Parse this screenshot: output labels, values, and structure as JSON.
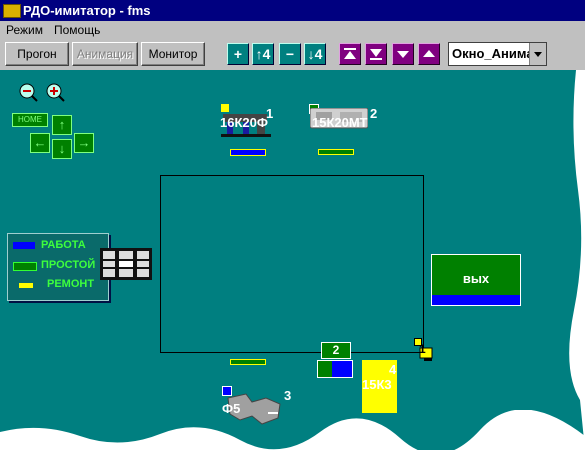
{
  "window": {
    "title": "РДО-имитатор - fms"
  },
  "menu": {
    "items": [
      "Режим",
      "Помощь"
    ]
  },
  "toolbar": {
    "run_label": "Прогон",
    "animation_label": "Анимация",
    "monitor_label": "Монитор",
    "plus_label": "+",
    "up4_label": "↑4",
    "minus_label": "−",
    "down4_label": "↓4",
    "frame_select_value": "Окно_Анима"
  },
  "zoom": {
    "home_label": "HOME"
  },
  "legend": {
    "items": [
      {
        "label": "РАБОТА",
        "color": "#0000ff"
      },
      {
        "label": "ПРОСТОЙ",
        "color": "#008000"
      },
      {
        "label": "РЕМОНТ",
        "color": "#ffff00"
      }
    ]
  },
  "machines": [
    {
      "number": "1",
      "label": "16К20Ф"
    },
    {
      "number": "2",
      "label": "15К20МТ"
    },
    {
      "number": "3",
      "label": "Ф5"
    },
    {
      "number": "4",
      "label": "15К3"
    }
  ],
  "output": {
    "label": "вых"
  },
  "queue": {
    "label": "2"
  },
  "robot": {
    "number": "1"
  },
  "colors": {
    "canvas": "#007f80",
    "work": "#0000ff",
    "idle": "#008000",
    "repair": "#ffff00",
    "titlebar": "#000080"
  }
}
